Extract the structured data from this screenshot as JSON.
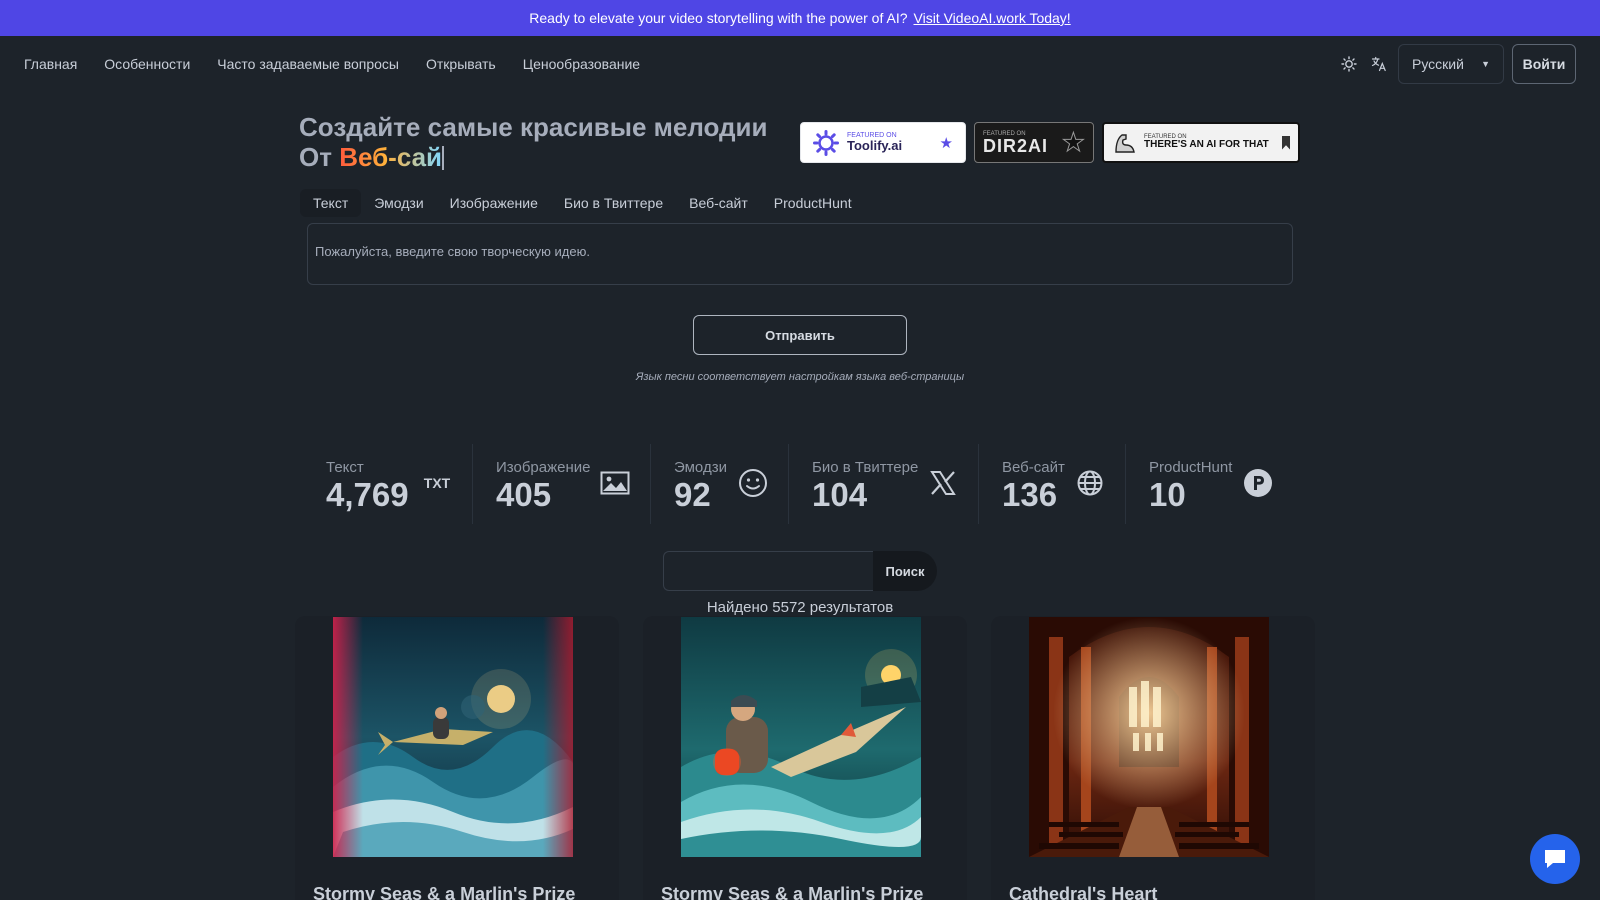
{
  "banner": {
    "text": "Ready to elevate your video storytelling with the power of AI?",
    "link": "Visit VideoAI.work Today!"
  },
  "nav": {
    "links": [
      "Главная",
      "Особенности",
      "Часто задаваемые вопросы",
      "Открывать",
      "Ценообразование"
    ],
    "language": "Русский",
    "login": "Войти"
  },
  "hero": {
    "title_line1": "Создайте самые красивые мелодии",
    "title_line2_prefix": "От",
    "title_line2_highlight": "Веб-сай"
  },
  "badges": {
    "toolify_small": "FEATURED ON",
    "toolify_name": "Toolify.ai",
    "dir2ai_small": "FEATURED ON",
    "dir2ai_name": "DIR2AI",
    "aift_small": "FEATURED ON",
    "aift_name": "THERE'S AN AI FOR THAT"
  },
  "tabs": [
    "Текст",
    "Эмодзи",
    "Изображение",
    "Био в Твиттере",
    "Веб-сайт",
    "ProductHunt"
  ],
  "input": {
    "placeholder": "Пожалуйста, введите свою творческую идею."
  },
  "submit_label": "Отправить",
  "language_note": "Язык песни соответствует настройкам языка веб-страницы",
  "stats": [
    {
      "title": "Текст",
      "value": "4,769",
      "icon": "txt-icon"
    },
    {
      "title": "Изображение",
      "value": "405",
      "icon": "image-icon"
    },
    {
      "title": "Эмодзи",
      "value": "92",
      "icon": "smiley-icon"
    },
    {
      "title": "Био в Твиттере",
      "value": "104",
      "icon": "x-logo-icon"
    },
    {
      "title": "Веб-сайт",
      "value": "136",
      "icon": "globe-icon"
    },
    {
      "title": "ProductHunt",
      "value": "10",
      "icon": "producthunt-icon"
    }
  ],
  "stats_txt_icon_label": "TXT",
  "search": {
    "button": "Поиск"
  },
  "results": {
    "count_text": "Найдено 5572 результатов"
  },
  "cards": [
    {
      "title": "Stormy Seas & a Marlin's Prize"
    },
    {
      "title": "Stormy Seas & a Marlin's Prize"
    },
    {
      "title": "Cathedral's Heart"
    }
  ],
  "colors": {
    "banner": "#4f46e5",
    "background": "#1d232a",
    "chat_button": "#2563eb"
  }
}
